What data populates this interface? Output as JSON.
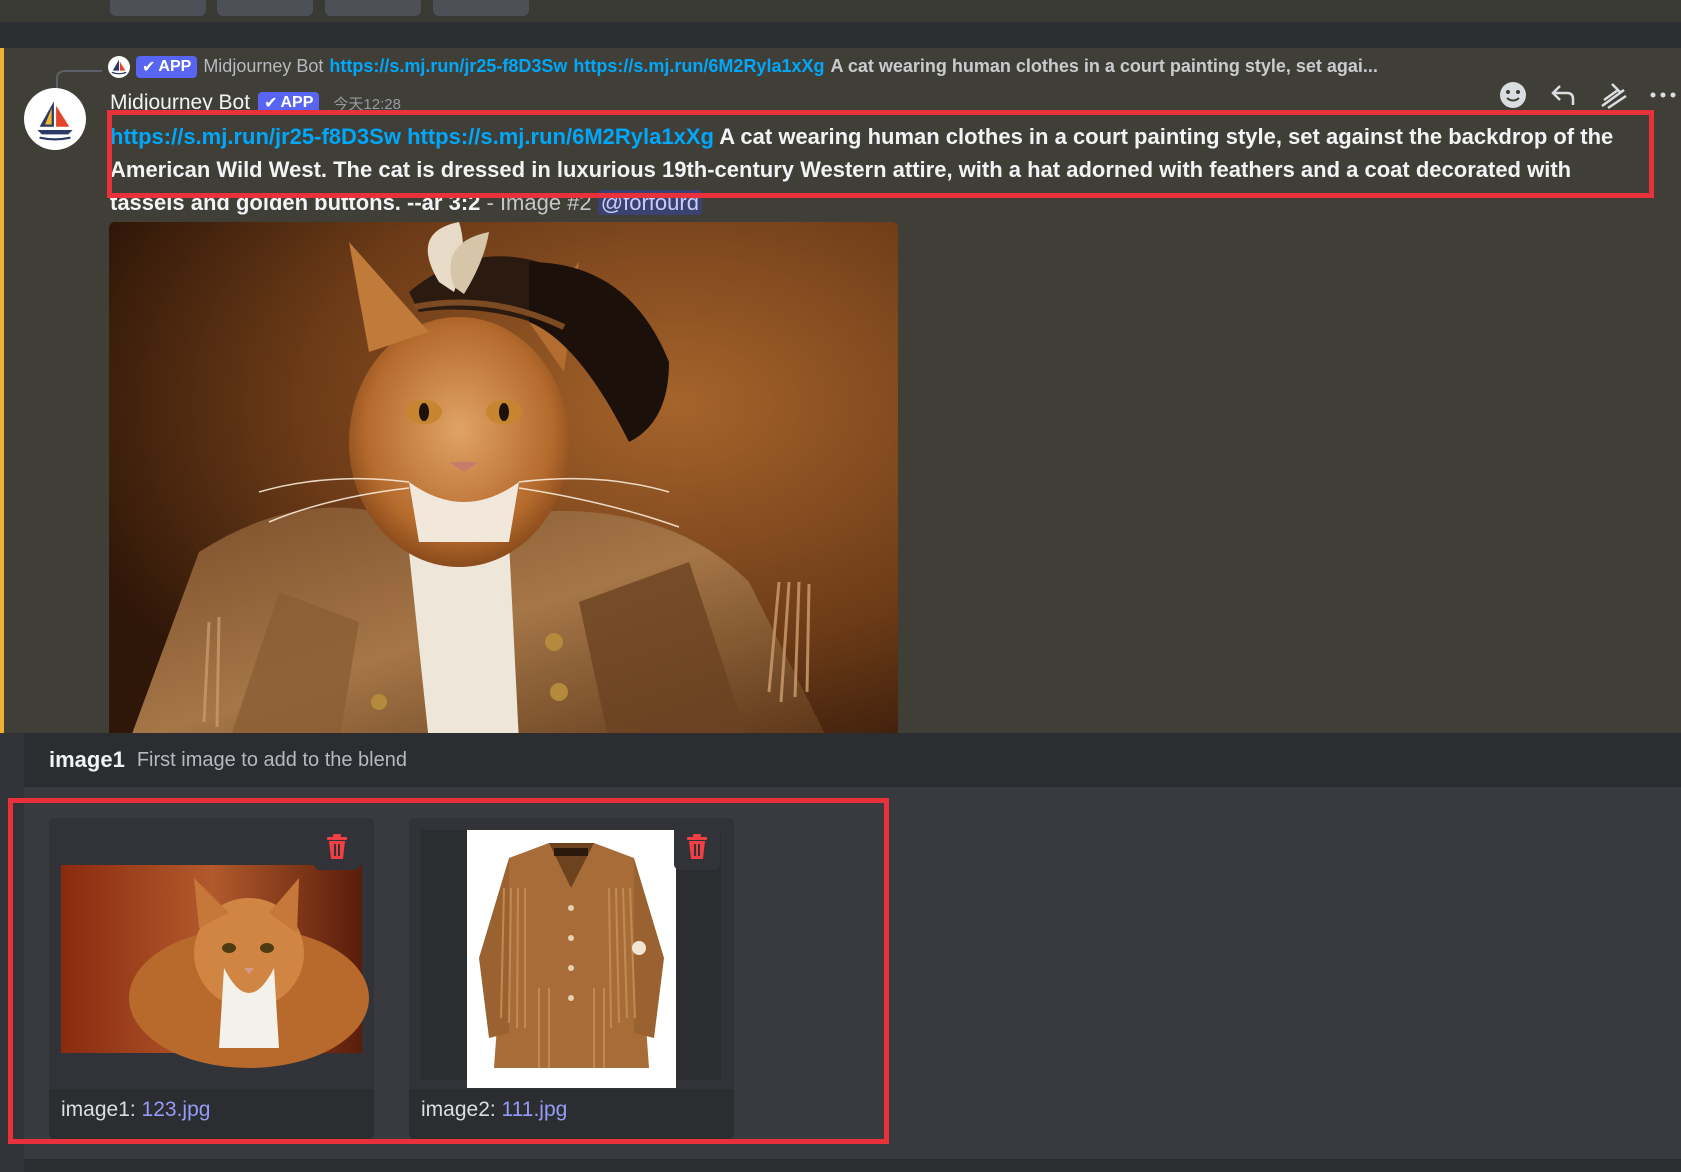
{
  "reply": {
    "author": "Midjourney Bot",
    "badge": "APP",
    "link1": "https://s.mj.run/jr25-f8D3Sw",
    "link2": "https://s.mj.run/6M2Ryla1xXg",
    "text": "A cat wearing human clothes in a court painting style, set agai..."
  },
  "message": {
    "author": "Midjourney Bot",
    "badge": "APP",
    "timestamp": "今天12:28",
    "link1": "https://s.mj.run/jr25-f8D3Sw",
    "link2": "https://s.mj.run/6M2Ryla1xXg",
    "prompt": "A cat wearing human clothes in a court painting style, set against the backdrop of the American Wild West. The cat is dressed in luxurious 19th-century Western attire, with a hat adorned with feathers and a coat decorated with tassels and golden buttons. --ar 3:2",
    "meta": " - Image #2 ",
    "mention": "@forfourd"
  },
  "toolbar": {
    "icons": [
      "add-reaction-icon",
      "reply-icon",
      "app-command-icon",
      "more-icon"
    ]
  },
  "command": {
    "option_name": "image1",
    "option_description": "First image to add to the blend",
    "attachments": [
      {
        "label": "image1: ",
        "file": "123.jpg"
      },
      {
        "label": "image2: ",
        "file": "111.jpg"
      }
    ]
  },
  "colors": {
    "highlight": "#e8313a",
    "link": "#00a8fc",
    "app_badge": "#5865f2",
    "mention_bar": "#f0b132",
    "delete": "#f23f43"
  }
}
